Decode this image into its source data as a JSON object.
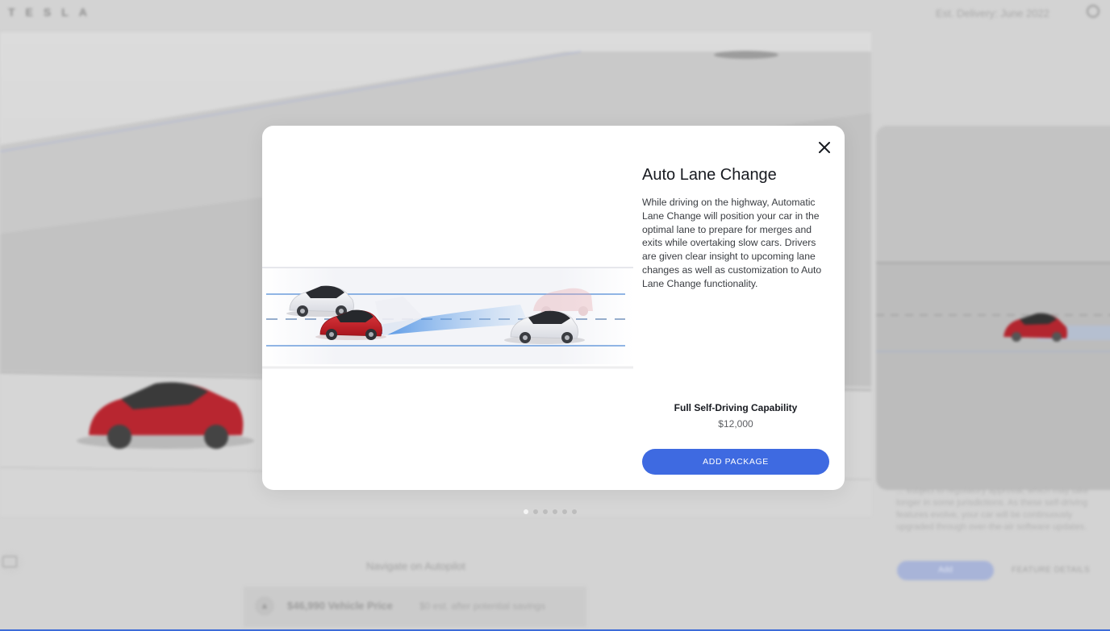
{
  "header": {
    "logo_text": "TESLA",
    "delivery_text": "Est. Delivery: June 2022"
  },
  "modal": {
    "title": "Auto Lane Change",
    "description": "While driving on the highway, Automatic Lane Change will position your car in the optimal lane to prepare for merges and exits while overtaking slow cars. Drivers are given clear insight to upcoming lane changes as well as customization to Auto Lane Change functionality.",
    "package_name": "Full Self-Driving Capability",
    "package_price": "$12,000",
    "add_button_label": "ADD PACKAGE",
    "close_icon": "close-icon"
  },
  "carousel": {
    "total_slides": 6,
    "active_slide": 1
  },
  "background": {
    "right_card_text": "... subject to regulatory approval, which may take longer in some jurisdictions. As these self-driving features evolve, your car will be continuously upgraded through over-the-air software updates.",
    "right_card_button": "Add",
    "right_card_link": "FEATURE DETAILS",
    "nav_title": "Navigate on Autopilot",
    "price_text": "$46,990 Vehicle Price",
    "savings_text": "$0 est. after potential savings"
  },
  "colors": {
    "accent": "#3e6ae1",
    "car_red": "#c8202a",
    "lane_line": "#4f8ad6"
  }
}
